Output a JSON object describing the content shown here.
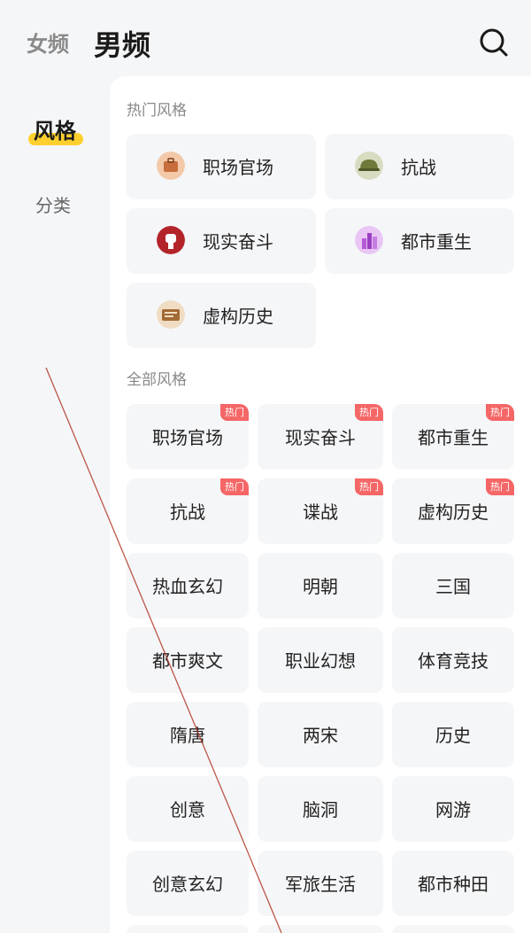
{
  "header": {
    "tab_female": "女频",
    "tab_male": "男频"
  },
  "sidebar": {
    "items": [
      {
        "label": "风格"
      },
      {
        "label": "分类"
      }
    ]
  },
  "popular": {
    "title": "热门风格",
    "items": [
      {
        "label": "职场官场",
        "icon": "briefcase-icon",
        "color": "#c86d3d"
      },
      {
        "label": "抗战",
        "icon": "helmet-icon",
        "color": "#6f7a3a"
      },
      {
        "label": "现实奋斗",
        "icon": "fist-icon",
        "color": "#b3242a"
      },
      {
        "label": "都市重生",
        "icon": "city-icon",
        "color": "#b45bd6"
      },
      {
        "label": "虚构历史",
        "icon": "scroll-icon",
        "color": "#a36a35"
      }
    ]
  },
  "all": {
    "title": "全部风格",
    "badge_label": "热门",
    "items": [
      {
        "label": "职场官场",
        "hot": true
      },
      {
        "label": "现实奋斗",
        "hot": true
      },
      {
        "label": "都市重生",
        "hot": true
      },
      {
        "label": "抗战",
        "hot": true
      },
      {
        "label": "谍战",
        "hot": true
      },
      {
        "label": "虚构历史",
        "hot": true
      },
      {
        "label": "热血玄幻",
        "hot": false
      },
      {
        "label": "明朝",
        "hot": false
      },
      {
        "label": "三国",
        "hot": false
      },
      {
        "label": "都市爽文",
        "hot": false
      },
      {
        "label": "职业幻想",
        "hot": false
      },
      {
        "label": "体育竞技",
        "hot": false
      },
      {
        "label": "隋唐",
        "hot": false
      },
      {
        "label": "两宋",
        "hot": false
      },
      {
        "label": "历史",
        "hot": false
      },
      {
        "label": "创意",
        "hot": false
      },
      {
        "label": "脑洞",
        "hot": false
      },
      {
        "label": "网游",
        "hot": false
      },
      {
        "label": "创意玄幻",
        "hot": false
      },
      {
        "label": "军旅生活",
        "hot": false
      },
      {
        "label": "都市种田",
        "hot": false
      }
    ]
  },
  "colors": {
    "accent": "#ffcf2e",
    "badge": "#f56666"
  }
}
